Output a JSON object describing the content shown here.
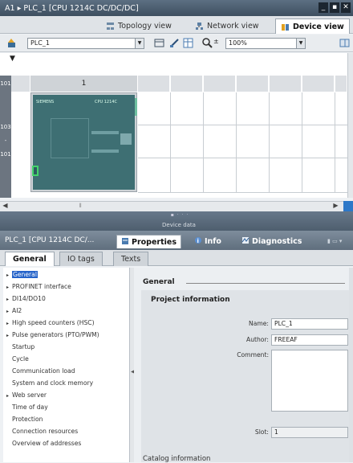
{
  "title_bar": {
    "breadcrumb": "A1 ▸ PLC_1 [CPU 1214C DC/DC/DC]",
    "controls": [
      "_",
      "▪",
      "✕"
    ]
  },
  "view_tabs": [
    {
      "label": "Topology view"
    },
    {
      "label": "Network view"
    },
    {
      "label": "Device view"
    }
  ],
  "toolbar": {
    "device_select": "PLC_1",
    "zoom": "100%"
  },
  "canvas": {
    "slot_label": "1",
    "row_labels": [
      "101",
      "103",
      "-",
      "101"
    ],
    "cpu_brand": "SIEMENS",
    "cpu_model": "CPU 1214C"
  },
  "device_data_label": "Device data",
  "inspector": {
    "title": "PLC_1 [CPU 1214C DC/...",
    "tabs": [
      {
        "label": "Properties"
      },
      {
        "label": "Info"
      },
      {
        "label": "Diagnostics"
      }
    ],
    "subtabs": [
      "General",
      "IO tags",
      "Texts"
    ]
  },
  "tree": [
    {
      "label": "General",
      "arrow": "▸",
      "selected": true
    },
    {
      "label": "PROFINET interface",
      "arrow": "▸"
    },
    {
      "label": "DI14/DO10",
      "arrow": "▸"
    },
    {
      "label": "AI2",
      "arrow": "▸"
    },
    {
      "label": "High speed counters (HSC)",
      "arrow": "▸"
    },
    {
      "label": "Pulse generators (PTO/PWM)",
      "arrow": "▸"
    },
    {
      "label": "Startup",
      "arrow": ""
    },
    {
      "label": "Cycle",
      "arrow": ""
    },
    {
      "label": "Communication load",
      "arrow": ""
    },
    {
      "label": "System and clock memory",
      "arrow": ""
    },
    {
      "label": "Web server",
      "arrow": "▸"
    },
    {
      "label": "Time of day",
      "arrow": ""
    },
    {
      "label": "Protection",
      "arrow": ""
    },
    {
      "label": "Connection resources",
      "arrow": ""
    },
    {
      "label": "Overview of addresses",
      "arrow": ""
    }
  ],
  "content": {
    "section_title": "General",
    "panel_title": "Project information",
    "fields": {
      "name_label": "Name:",
      "name_value": "PLC_1",
      "author_label": "Author:",
      "author_value": "FREEAF",
      "comment_label": "Comment:",
      "comment_value": "",
      "slot_label": "Slot:",
      "slot_value": "1"
    },
    "catalog_title": "Catalog information"
  },
  "colors": {
    "title_bar": "#3e4f60",
    "plc_body": "#3e6f73",
    "selection": "#2563c9",
    "status_led": "#44d36b"
  }
}
